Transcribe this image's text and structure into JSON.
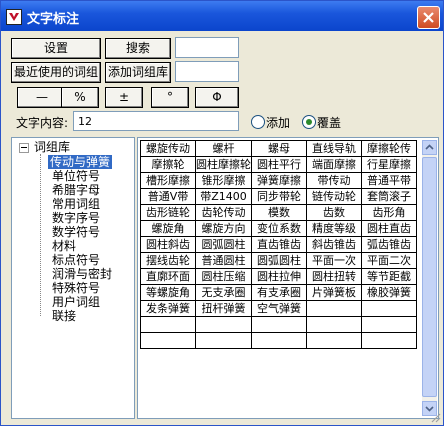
{
  "window": {
    "title": "文字标注"
  },
  "toolbar": {
    "settings_label": "设置",
    "search_label": "搜索",
    "recent_label": "最近使用的词组",
    "add_phrase_lib_label": "添加词组库",
    "symbols": [
      "—",
      "%",
      "±",
      "°",
      "Φ"
    ]
  },
  "text_content": {
    "label": "文字内容:",
    "value": "12"
  },
  "mode": {
    "add_label": "添加",
    "overwrite_label": "覆盖",
    "selected": "覆盖"
  },
  "tree": {
    "root": "词组库",
    "items": [
      "传动与弹簧",
      "单位符号",
      "希腊字母",
      "常用词组",
      "数字序号",
      "数学符号",
      "材料",
      "标点符号",
      "润滑与密封",
      "特殊符号",
      "用户词组",
      "联接"
    ],
    "selected": "传动与弹簧"
  },
  "phrases": [
    [
      "螺旋传动",
      "螺杆",
      "螺母",
      "直线导轨",
      "摩擦轮传"
    ],
    [
      "摩擦轮",
      "圆柱摩擦轮",
      "圆柱平行",
      "端面摩擦",
      "行星摩擦"
    ],
    [
      "槽形摩擦",
      "锥形摩擦",
      "弹簧摩擦",
      "带传动",
      "普通平带"
    ],
    [
      "普通V带",
      "带Z1400",
      "同步带轮",
      "链传动轮",
      "套筒滚子"
    ],
    [
      "齿形链轮",
      "齿轮传动",
      "模数",
      "齿数",
      "齿形角"
    ],
    [
      "螺旋角",
      "螺旋方向",
      "变位系数",
      "精度等级",
      "圆柱直齿"
    ],
    [
      "圆柱斜齿",
      "圆弧圆柱",
      "直齿锥齿",
      "斜齿锥齿",
      "弧齿锥齿"
    ],
    [
      "摆线齿轮",
      "普通圆柱",
      "圆弧圆柱",
      "平面一次",
      "平面二次"
    ],
    [
      "直廓环面",
      "圆柱压缩",
      "圆柱拉伸",
      "圆柱扭转",
      "等节距截"
    ],
    [
      "等螺旋角",
      "无支承圈",
      "有支承圈",
      "片弹簧板",
      "橡胶弹簧"
    ],
    [
      "发条弹簧",
      "扭杆弹簧",
      "空气弹簧",
      "",
      ""
    ],
    [
      "",
      "",
      "",
      "",
      ""
    ],
    [
      "",
      "",
      "",
      "",
      ""
    ]
  ]
}
